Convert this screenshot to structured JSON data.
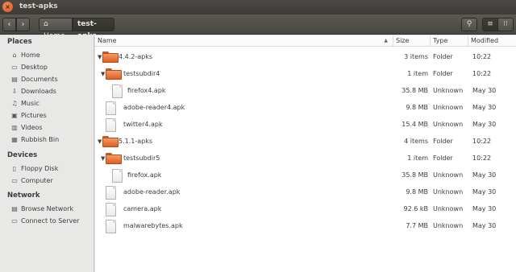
{
  "window": {
    "title": "test-apks",
    "close_glyph": "×"
  },
  "toolbar": {
    "back_glyph": "‹",
    "forward_glyph": "›",
    "home_icon": "⌂",
    "home_label": "Home",
    "current_label": "test-apks",
    "search_glyph": "⚲",
    "list_glyph": "≡",
    "grid_glyph": "⁝⁝"
  },
  "sidebar": {
    "places_heading": "Places",
    "devices_heading": "Devices",
    "network_heading": "Network",
    "places": [
      {
        "label": "Home",
        "icon": "⌂"
      },
      {
        "label": "Desktop",
        "icon": "▭"
      },
      {
        "label": "Documents",
        "icon": "▤"
      },
      {
        "label": "Downloads",
        "icon": "⇩"
      },
      {
        "label": "Music",
        "icon": "♫"
      },
      {
        "label": "Pictures",
        "icon": "▣"
      },
      {
        "label": "Videos",
        "icon": "▥"
      },
      {
        "label": "Rubbish Bin",
        "icon": "▦"
      }
    ],
    "devices": [
      {
        "label": "Floppy Disk",
        "icon": "▯"
      },
      {
        "label": "Computer",
        "icon": "▭"
      }
    ],
    "network": [
      {
        "label": "Browse Network",
        "icon": "▤"
      },
      {
        "label": "Connect to Server",
        "icon": "▭"
      }
    ]
  },
  "columns": {
    "name": "Name",
    "size": "Size",
    "type": "Type",
    "modified": "Modified",
    "sort_glyph": "▲"
  },
  "rows": [
    {
      "name": "4.4.2-apks",
      "size": "3 items",
      "type": "Folder",
      "modified": "10:22",
      "kind": "folder",
      "expander": "▼"
    },
    {
      "name": "testsubdir4",
      "size": "1 item",
      "type": "Folder",
      "modified": "10:22",
      "kind": "folder",
      "expander": "▼"
    },
    {
      "name": "firefox4.apk",
      "size": "35.8 MB",
      "type": "Unknown",
      "modified": "May 30",
      "kind": "file"
    },
    {
      "name": "adobe-reader4.apk",
      "size": "9.8 MB",
      "type": "Unknown",
      "modified": "May 30",
      "kind": "file"
    },
    {
      "name": "twitter4.apk",
      "size": "15.4 MB",
      "type": "Unknown",
      "modified": "May 30",
      "kind": "file"
    },
    {
      "name": "5.1.1-apks",
      "size": "4 items",
      "type": "Folder",
      "modified": "10:22",
      "kind": "folder",
      "expander": "▼"
    },
    {
      "name": "testsubdir5",
      "size": "1 item",
      "type": "Folder",
      "modified": "10:22",
      "kind": "folder",
      "expander": "▼"
    },
    {
      "name": "firefox.apk",
      "size": "35.8 MB",
      "type": "Unknown",
      "modified": "May 30",
      "kind": "file"
    },
    {
      "name": "adobe-reader.apk",
      "size": "9.8 MB",
      "type": "Unknown",
      "modified": "May 30",
      "kind": "file"
    },
    {
      "name": "camera.apk",
      "size": "92.6 kB",
      "type": "Unknown",
      "modified": "May 30",
      "kind": "file"
    },
    {
      "name": "malwarebytes.apk",
      "size": "7.7 MB",
      "type": "Unknown",
      "modified": "May 30",
      "kind": "file"
    }
  ]
}
